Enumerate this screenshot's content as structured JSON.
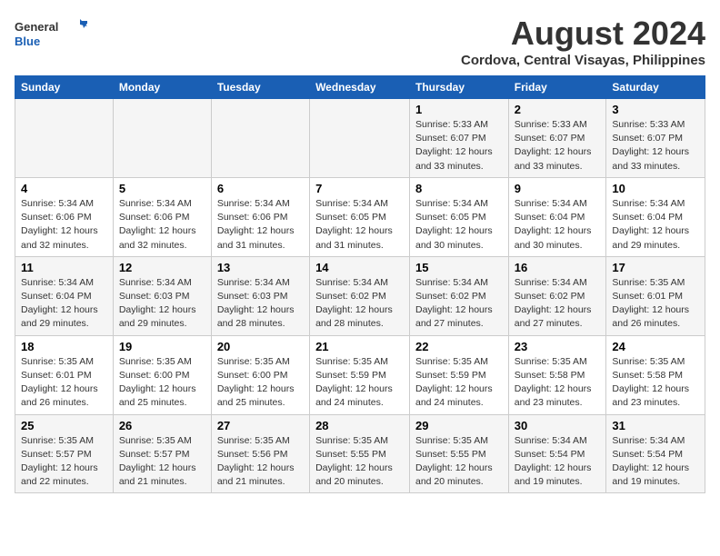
{
  "logo": {
    "line1": "General",
    "line2": "Blue"
  },
  "title": "August 2024",
  "subtitle": "Cordova, Central Visayas, Philippines",
  "days_of_week": [
    "Sunday",
    "Monday",
    "Tuesday",
    "Wednesday",
    "Thursday",
    "Friday",
    "Saturday"
  ],
  "weeks": [
    [
      {
        "day": "",
        "info": ""
      },
      {
        "day": "",
        "info": ""
      },
      {
        "day": "",
        "info": ""
      },
      {
        "day": "",
        "info": ""
      },
      {
        "day": "1",
        "info": "Sunrise: 5:33 AM\nSunset: 6:07 PM\nDaylight: 12 hours\nand 33 minutes."
      },
      {
        "day": "2",
        "info": "Sunrise: 5:33 AM\nSunset: 6:07 PM\nDaylight: 12 hours\nand 33 minutes."
      },
      {
        "day": "3",
        "info": "Sunrise: 5:33 AM\nSunset: 6:07 PM\nDaylight: 12 hours\nand 33 minutes."
      }
    ],
    [
      {
        "day": "4",
        "info": "Sunrise: 5:34 AM\nSunset: 6:06 PM\nDaylight: 12 hours\nand 32 minutes."
      },
      {
        "day": "5",
        "info": "Sunrise: 5:34 AM\nSunset: 6:06 PM\nDaylight: 12 hours\nand 32 minutes."
      },
      {
        "day": "6",
        "info": "Sunrise: 5:34 AM\nSunset: 6:06 PM\nDaylight: 12 hours\nand 31 minutes."
      },
      {
        "day": "7",
        "info": "Sunrise: 5:34 AM\nSunset: 6:05 PM\nDaylight: 12 hours\nand 31 minutes."
      },
      {
        "day": "8",
        "info": "Sunrise: 5:34 AM\nSunset: 6:05 PM\nDaylight: 12 hours\nand 30 minutes."
      },
      {
        "day": "9",
        "info": "Sunrise: 5:34 AM\nSunset: 6:04 PM\nDaylight: 12 hours\nand 30 minutes."
      },
      {
        "day": "10",
        "info": "Sunrise: 5:34 AM\nSunset: 6:04 PM\nDaylight: 12 hours\nand 29 minutes."
      }
    ],
    [
      {
        "day": "11",
        "info": "Sunrise: 5:34 AM\nSunset: 6:04 PM\nDaylight: 12 hours\nand 29 minutes."
      },
      {
        "day": "12",
        "info": "Sunrise: 5:34 AM\nSunset: 6:03 PM\nDaylight: 12 hours\nand 29 minutes."
      },
      {
        "day": "13",
        "info": "Sunrise: 5:34 AM\nSunset: 6:03 PM\nDaylight: 12 hours\nand 28 minutes."
      },
      {
        "day": "14",
        "info": "Sunrise: 5:34 AM\nSunset: 6:02 PM\nDaylight: 12 hours\nand 28 minutes."
      },
      {
        "day": "15",
        "info": "Sunrise: 5:34 AM\nSunset: 6:02 PM\nDaylight: 12 hours\nand 27 minutes."
      },
      {
        "day": "16",
        "info": "Sunrise: 5:34 AM\nSunset: 6:02 PM\nDaylight: 12 hours\nand 27 minutes."
      },
      {
        "day": "17",
        "info": "Sunrise: 5:35 AM\nSunset: 6:01 PM\nDaylight: 12 hours\nand 26 minutes."
      }
    ],
    [
      {
        "day": "18",
        "info": "Sunrise: 5:35 AM\nSunset: 6:01 PM\nDaylight: 12 hours\nand 26 minutes."
      },
      {
        "day": "19",
        "info": "Sunrise: 5:35 AM\nSunset: 6:00 PM\nDaylight: 12 hours\nand 25 minutes."
      },
      {
        "day": "20",
        "info": "Sunrise: 5:35 AM\nSunset: 6:00 PM\nDaylight: 12 hours\nand 25 minutes."
      },
      {
        "day": "21",
        "info": "Sunrise: 5:35 AM\nSunset: 5:59 PM\nDaylight: 12 hours\nand 24 minutes."
      },
      {
        "day": "22",
        "info": "Sunrise: 5:35 AM\nSunset: 5:59 PM\nDaylight: 12 hours\nand 24 minutes."
      },
      {
        "day": "23",
        "info": "Sunrise: 5:35 AM\nSunset: 5:58 PM\nDaylight: 12 hours\nand 23 minutes."
      },
      {
        "day": "24",
        "info": "Sunrise: 5:35 AM\nSunset: 5:58 PM\nDaylight: 12 hours\nand 23 minutes."
      }
    ],
    [
      {
        "day": "25",
        "info": "Sunrise: 5:35 AM\nSunset: 5:57 PM\nDaylight: 12 hours\nand 22 minutes."
      },
      {
        "day": "26",
        "info": "Sunrise: 5:35 AM\nSunset: 5:57 PM\nDaylight: 12 hours\nand 21 minutes."
      },
      {
        "day": "27",
        "info": "Sunrise: 5:35 AM\nSunset: 5:56 PM\nDaylight: 12 hours\nand 21 minutes."
      },
      {
        "day": "28",
        "info": "Sunrise: 5:35 AM\nSunset: 5:55 PM\nDaylight: 12 hours\nand 20 minutes."
      },
      {
        "day": "29",
        "info": "Sunrise: 5:35 AM\nSunset: 5:55 PM\nDaylight: 12 hours\nand 20 minutes."
      },
      {
        "day": "30",
        "info": "Sunrise: 5:34 AM\nSunset: 5:54 PM\nDaylight: 12 hours\nand 19 minutes."
      },
      {
        "day": "31",
        "info": "Sunrise: 5:34 AM\nSunset: 5:54 PM\nDaylight: 12 hours\nand 19 minutes."
      }
    ]
  ]
}
